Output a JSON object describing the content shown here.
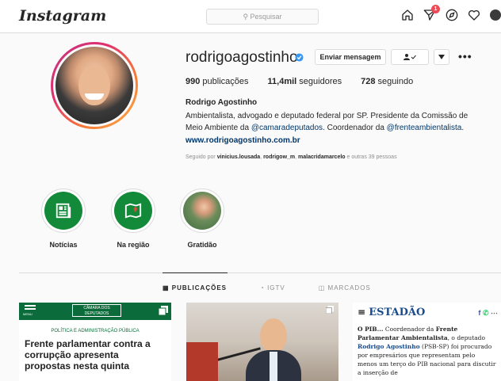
{
  "header": {
    "logo": "Instagram",
    "search_placeholder": "Pesquisar",
    "notifications_count": "1"
  },
  "profile": {
    "username": "rodrigoagostinho",
    "message_button": "Enviar mensagem",
    "stats": {
      "posts_value": "990",
      "posts_label": "publicações",
      "followers_value": "11,4mil",
      "followers_label": "seguidores",
      "following_value": "728",
      "following_label": "seguindo"
    },
    "full_name": "Rodrigo Agostinho",
    "bio_line1": "Ambientalista, advogado e deputado federal por SP. Presidente da Comissão de",
    "bio_line2_prefix": "Meio Ambiente da ",
    "bio_mention1": "@camaradeputados",
    "bio_line2_middle": ". Coordenador da ",
    "bio_mention2": "@frenteambientalista",
    "bio_line2_suffix": ".",
    "website": "www.rodrigoagostinho.com.br",
    "followed_prefix": "Seguido por",
    "followed_user1": "vinicius.lousada",
    "followed_user2": "rodrigow_m",
    "followed_user3": "malacridamarcelo",
    "followed_suffix": "e outras 39 pessoas"
  },
  "highlights": [
    {
      "label": "Notícias",
      "icon": "newspaper-icon"
    },
    {
      "label": "Na região",
      "icon": "map-pin-icon"
    },
    {
      "label": "Gratidão",
      "icon": "photo"
    }
  ],
  "tabs": [
    {
      "label": "PUBLICAÇÕES",
      "active": true
    },
    {
      "label": "IGTV",
      "active": false
    },
    {
      "label": "MARCADOS",
      "active": false
    }
  ],
  "posts": {
    "post1": {
      "header_text": "CÂMARA DOS DEPUTADOS",
      "menu_label": "MENU",
      "category": "POLÍTICA E ADMINISTRAÇÃO PÚBLICA",
      "title": "Frente parlamentar contra a corrupção apresenta propostas nesta quinta"
    },
    "post3": {
      "brand": "ESTADÃO",
      "text_bold": "O PIB...",
      "text1": " Coordenador da ",
      "text_bold2": "Frente Parlamentar Ambientalista",
      "text2": ", o deputado ",
      "text_link": "Rodrigo Agostinho",
      "text3": " (PSB-SP) foi procurado por empresários que representam pelo menos um terço do PIB nacional para discutir a inserção de"
    }
  },
  "colors": {
    "accent_blue": "#0095f6",
    "link_blue": "#00376b",
    "highlight_green": "#138a3a",
    "badge_red": "#ed4956"
  }
}
